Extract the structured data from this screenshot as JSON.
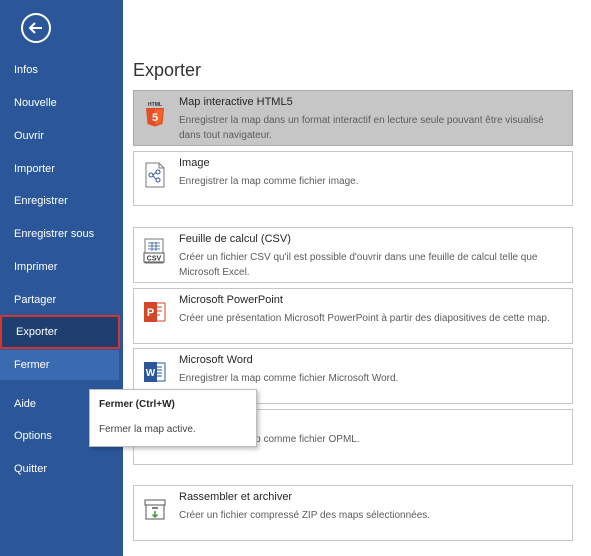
{
  "sidebar": {
    "items": [
      {
        "label": "Infos"
      },
      {
        "label": "Nouvelle"
      },
      {
        "label": "Ouvrir"
      },
      {
        "label": "Importer"
      },
      {
        "label": "Enregistrer"
      },
      {
        "label": "Enregistrer sous"
      },
      {
        "label": "Imprimer"
      },
      {
        "label": "Partager"
      },
      {
        "label": "Exporter"
      },
      {
        "label": "Fermer"
      },
      {
        "label": "Aide"
      },
      {
        "label": "Options"
      },
      {
        "label": "Quitter"
      }
    ],
    "active": "Exporter",
    "color": "#2b579a"
  },
  "main": {
    "title": "Exporter",
    "options": [
      {
        "name": "Map interactive HTML5",
        "desc": "Enregistrer la map dans un format interactif en lecture seule pouvant être visualisé dans tout navigateur.",
        "icon": "html5-icon",
        "selected": true
      },
      {
        "name": "Image",
        "desc": "Enregistrer la map comme fichier image.",
        "icon": "image-file-icon"
      },
      {
        "name": "Feuille de calcul (CSV)",
        "desc": "Créer un fichier CSV qu'il est possible d'ouvrir dans une feuille de calcul telle que Microsoft Excel.",
        "icon": "csv-icon"
      },
      {
        "name": "Microsoft PowerPoint",
        "desc": "Créer une présentation Microsoft PowerPoint à partir des diapositives de cette map.",
        "icon": "powerpoint-icon"
      },
      {
        "name": "Microsoft Word",
        "desc": "Enregistrer la map comme fichier Microsoft Word.",
        "icon": "word-icon"
      },
      {
        "name": "",
        "desc": "Enregistrer la map comme fichier OPML.",
        "icon": "opml-icon"
      },
      {
        "name": "Rassembler et archiver",
        "desc": "Créer un fichier compressé ZIP des maps sélectionnées.",
        "icon": "archive-icon"
      }
    ]
  },
  "tooltip": {
    "title": "Fermer (Ctrl+W)",
    "text": "Fermer la map active."
  }
}
